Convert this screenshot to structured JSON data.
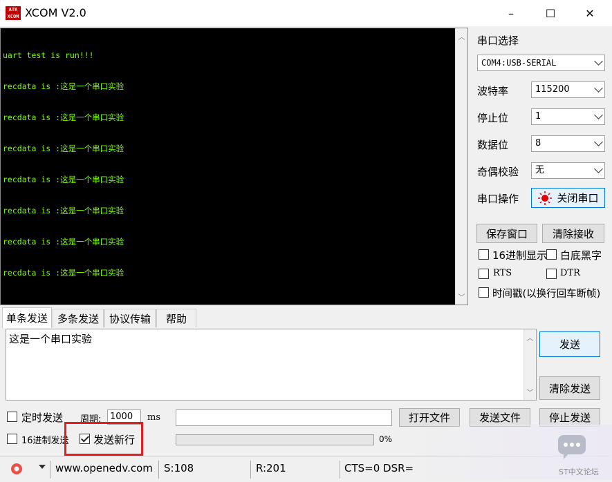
{
  "window": {
    "logo_text": "ATK XCOM",
    "title": "XCOM V2.0",
    "minimize": "–",
    "maximize": "☐",
    "close": "✕"
  },
  "receive": {
    "lines": [
      "uart test is run!!!",
      "recdata is :这是一个串口实验",
      "recdata is :这是一个串口实验",
      "recdata is :这是一个串口实验",
      "recdata is :这是一个串口实验",
      "recdata is :这是一个串口实验",
      "recdata is :这是一个串口实验",
      "recdata is :这是一个串口实验"
    ]
  },
  "settings": {
    "port_label": "串口选择",
    "port_value": "COM4:USB-SERIAL",
    "baud_label": "波特率",
    "baud_value": "115200",
    "stop_label": "停止位",
    "stop_value": "1",
    "data_label": "数据位",
    "data_value": "8",
    "parity_label": "奇偶校验",
    "parity_value": "无",
    "op_label": "串口操作",
    "op_button": "关闭串口",
    "save_window": "保存窗口",
    "clear_receive": "清除接收",
    "hex_display": "16进制显示",
    "white_black": "白底黑字",
    "rts": "RTS",
    "dtr": "DTR",
    "timestamp": "时间戳(以换行回车断帧)"
  },
  "tabs": [
    "单条发送",
    "多条发送",
    "协议传输",
    "帮助"
  ],
  "send": {
    "text": "这是一个串口实验",
    "send_button": "发送",
    "clear_send": "清除发送",
    "timed_send": "定时发送",
    "period_label": "周期:",
    "period_value": "1000",
    "period_unit": "ms",
    "hex_send": "16进制发送",
    "send_newline": "发送新行",
    "open_file": "打开文件",
    "send_file": "发送文件",
    "stop_send": "停止发送",
    "progress_text": "0%"
  },
  "status": {
    "url": "www.openedv.com",
    "sent": "S:108",
    "received": "R:201",
    "lines": "CTS=0 DSR=",
    "watermark": "ST中文论坛"
  },
  "colors": {
    "console_text": "#7cfc00",
    "console_bg": "#000000",
    "highlight": "#e02020"
  }
}
